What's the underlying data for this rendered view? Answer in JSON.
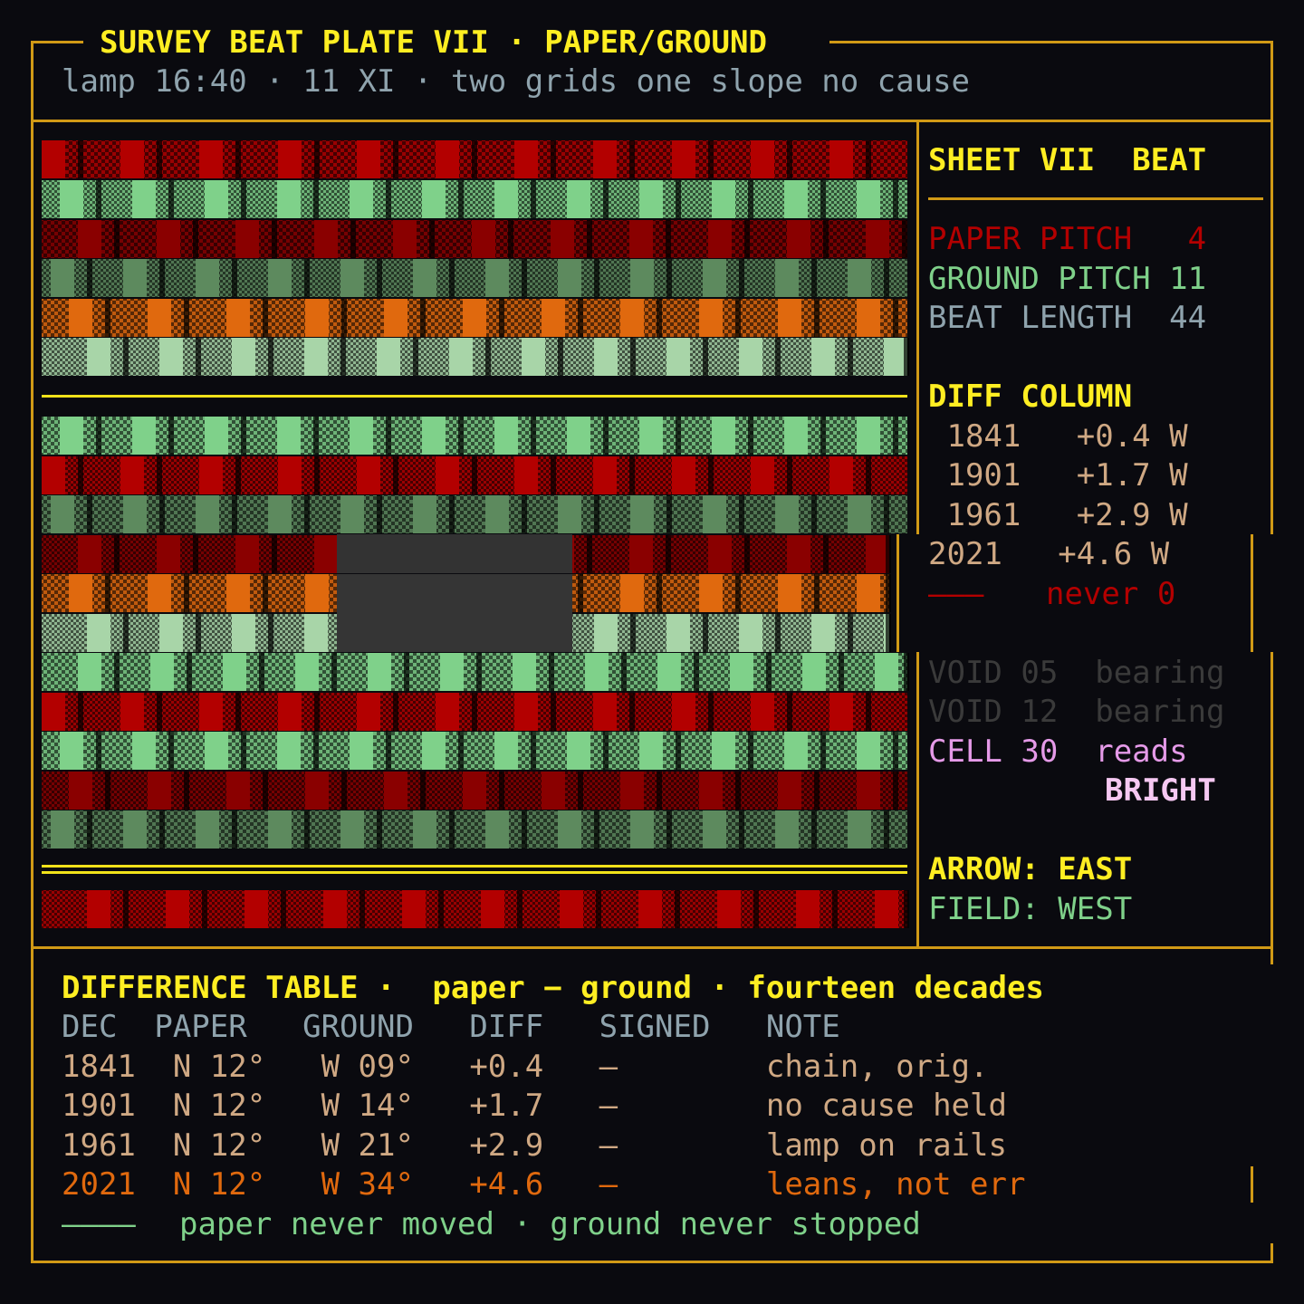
{
  "title": "SURVEY BEAT PLATE VII · PAPER/GROUND",
  "subtitle": "lamp 16:40 · 11 XI · two grids one slope no cause",
  "colors": {
    "frame": "#d19a16",
    "heading": "#ffee22",
    "paper_red": "#b30000",
    "ground_green": "#7fd18a",
    "muted_blue": "#8fa3ad",
    "tan": "#cfa883",
    "orange": "#e0690e",
    "pink": "#e59ae8",
    "dim": "#3a3a3a"
  },
  "side": {
    "sheet_title": "SHEET VII  BEAT",
    "paper_pitch": "PAPER PITCH   4",
    "ground_pitch": "GROUND PITCH 11",
    "beat_length": "BEAT LENGTH  44",
    "diff_title": "DIFF COLUMN",
    "diff_rows": [
      " 1841   +0.4 W",
      " 1901   +1.7 W",
      " 1961   +2.9 W",
      "2021   +4.6 W"
    ],
    "never_dash": "———",
    "never": "never 0",
    "void_1": "VOID 05  bearing",
    "void_2": "VOID 12  bearing",
    "cell": "CELL 30  reads",
    "bright": "BRIGHT",
    "arrow": "ARROW: EAST",
    "field": "FIELD: WEST"
  },
  "table": {
    "title": "DIFFERENCE TABLE ·  paper − ground · fourteen decades",
    "header": "DEC  PAPER   GROUND   DIFF   SIGNED   NOTE",
    "rows": [
      "1841  N 12°   W 09°   +0.4   —        chain, orig.",
      "1901  N 12°   W 14°   +1.7   —        no cause held",
      "1961  N 12°   W 21°   +2.9   —        lamp on rails"
    ],
    "highlight_row": "2021  N 12°   W 34°   +4.6   —        leans, not err",
    "footer_dash": "————",
    "footer": "paper never moved · ground never stopped"
  }
}
